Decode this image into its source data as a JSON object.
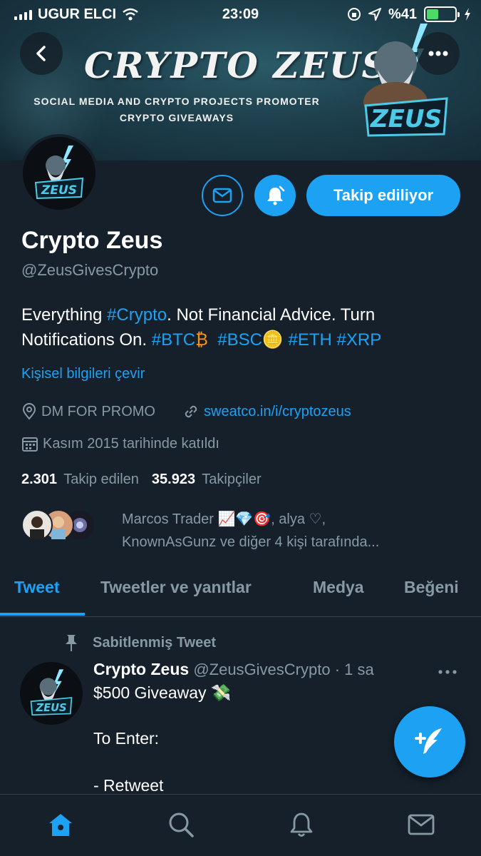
{
  "status_bar": {
    "carrier": "UGUR ELCI",
    "time": "23:09",
    "battery_percent": "%41",
    "battery_level": 0.41
  },
  "banner": {
    "title": "CRYPTO ZEUS",
    "subtitle_1": "SOCIAL MEDIA AND CRYPTO PROJECTS PROMOTER",
    "subtitle_2": "CRYPTO GIVEAWAYS",
    "logo_text": "ZEUS"
  },
  "profile": {
    "avatar_text": "ZEUS",
    "follow_button": "Takip ediliyor",
    "name": "Crypto Zeus",
    "handle": "@ZeusGivesCrypto",
    "bio": {
      "p1": "Everything ",
      "t1": "#Crypto",
      "p2": ". Not Financial Advice. Turn Notifications On. ",
      "t2": "#BTC",
      "e1": "₿",
      "t3": "#BSC",
      "e2": "🪙",
      "t4": "#ETH",
      "t5": "#XRP"
    },
    "translate_link": "Kişisel bilgileri çevir",
    "location": "DM FOR PROMO",
    "website": "sweatco.in/i/cryptozeus",
    "joined": "Kasım 2015 tarihinde katıldı",
    "following_count": "2.301",
    "following_label": "Takip edilen",
    "followers_count": "35.923",
    "followers_label": "Takipçiler",
    "followed_by_line1": "Marcos Trader 📈💎🎯, alya ♡,",
    "followed_by_line2": "KnownAsGunz ve diğer 4 kişi tarafında..."
  },
  "tabs": [
    "Tweet",
    "Tweetler ve yanıtlar",
    "Medya",
    "Beğeni"
  ],
  "tweet": {
    "pinned_label": "Sabitlenmiş Tweet",
    "author": "Crypto Zeus",
    "handle_time": "@ZeusGivesCrypto · 1 sa",
    "line1": "$500 Giveaway 💸",
    "line2": "To Enter:",
    "line3": "- Retweet"
  },
  "icons": {
    "back": "back-arrow-icon",
    "more": "more-icon",
    "mail": "mail-icon",
    "bell": "bell-icon",
    "location": "location-icon",
    "link": "link-icon",
    "calendar": "calendar-icon",
    "pin": "pin-icon",
    "compose": "compose-icon",
    "home": "home-icon",
    "search": "search-icon",
    "notifications": "notifications-icon",
    "messages": "messages-icon"
  },
  "colors": {
    "background": "#15202b",
    "accent": "#1da1f2",
    "secondary_text": "#8899a6",
    "battery": "#4cd964"
  }
}
